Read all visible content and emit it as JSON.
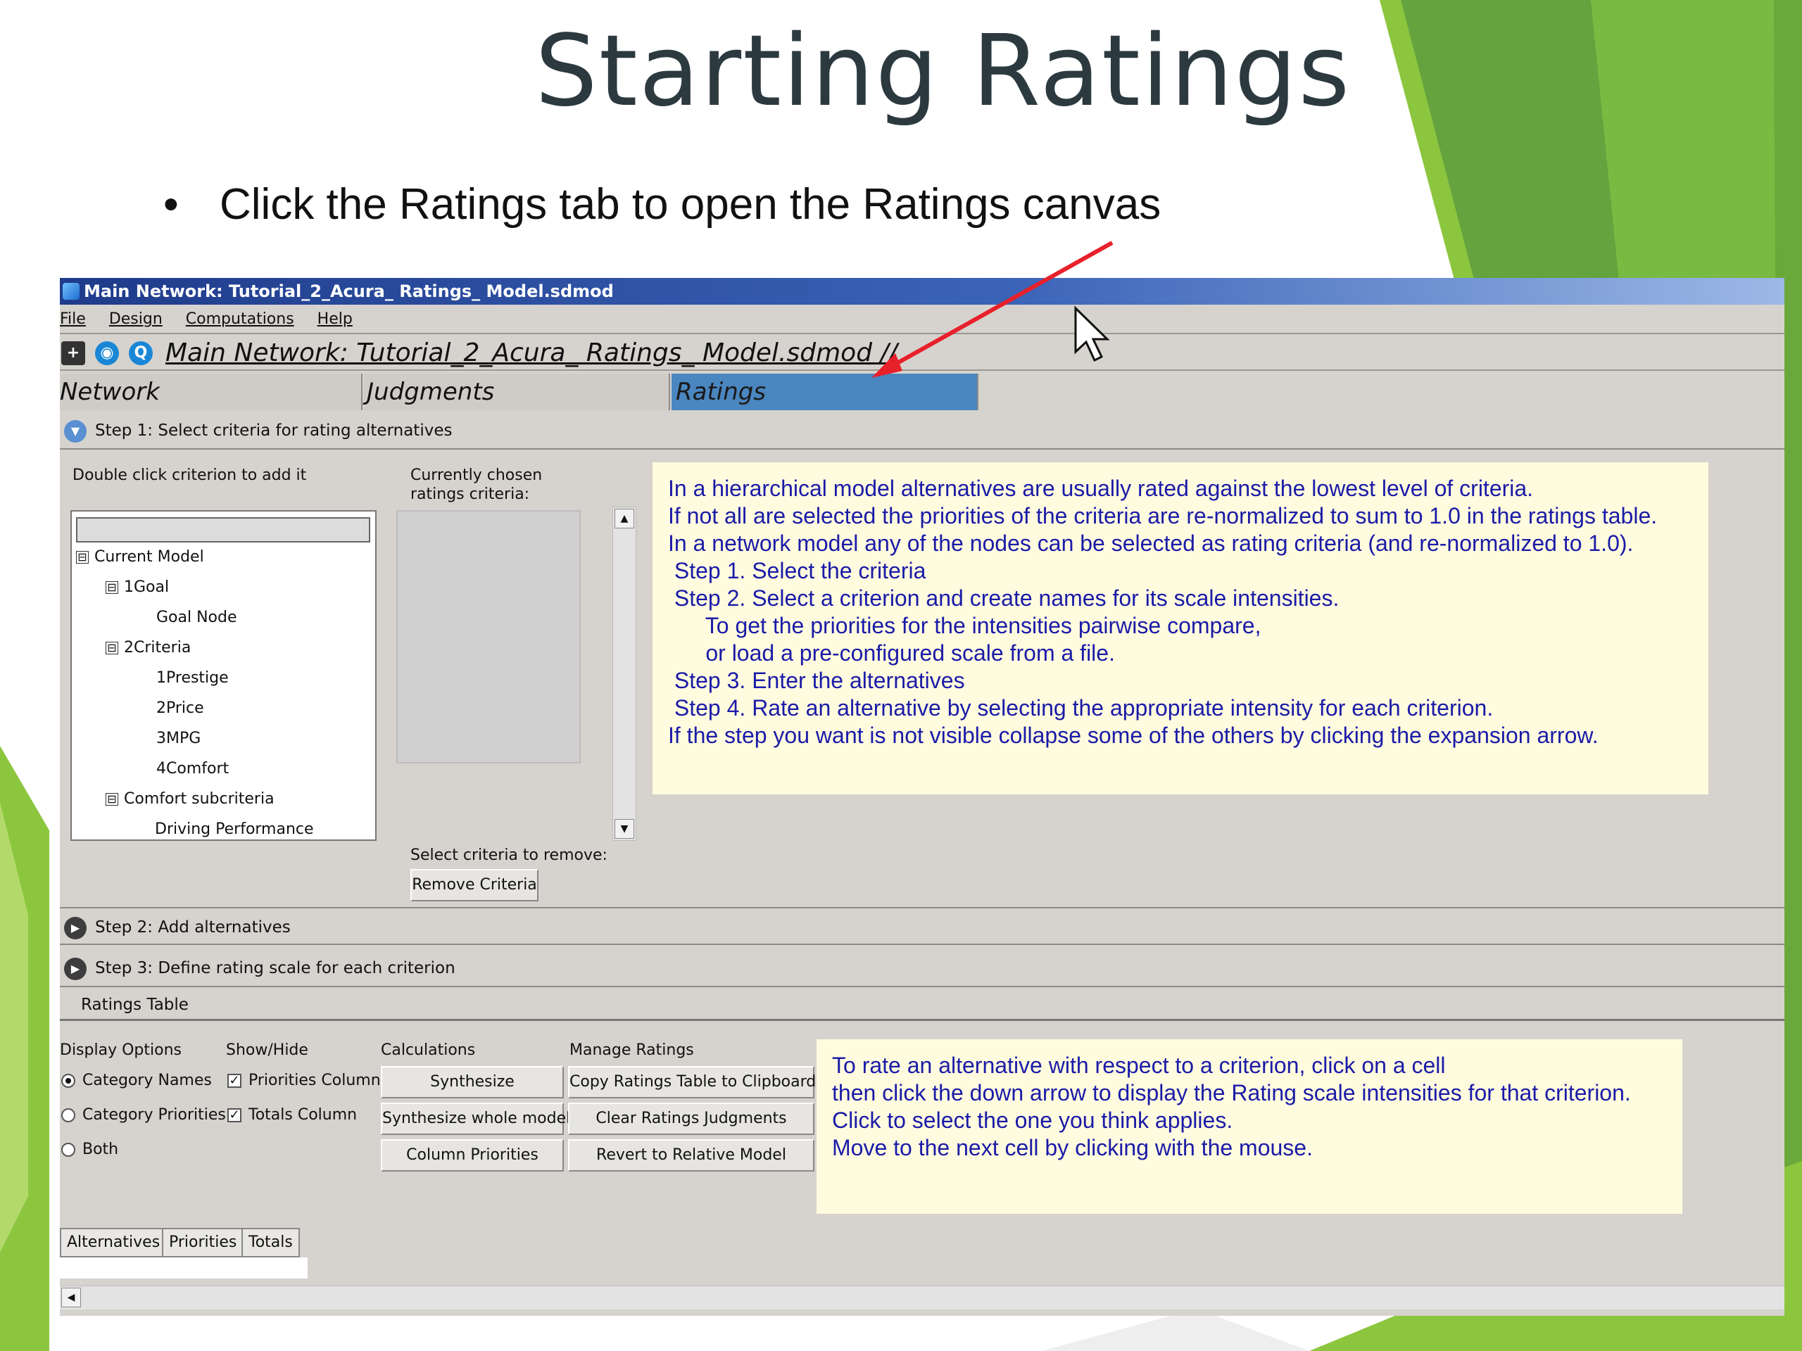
{
  "slide": {
    "title": "Starting Ratings",
    "bullet": "Click the Ratings tab to open the Ratings canvas",
    "bullet_marker": "•"
  },
  "colors": {
    "green_light": "#8cc63f",
    "green_dark": "#5a9a3c",
    "arrow_red": "#e8202a",
    "note_bg": "#fffbdf",
    "note_text": "#1b1ba7",
    "tab_active": "#4a86c0"
  },
  "window": {
    "title": "Main Network: Tutorial_2_Acura_ Ratings_ Model.sdmod",
    "menu": [
      "File",
      "Design",
      "Computations",
      "Help"
    ],
    "path": "Main Network: Tutorial_2_Acura_ Ratings_ Model.sdmod //",
    "tabs": [
      "Network",
      "Judgments",
      "Ratings"
    ],
    "active_tab": "Ratings"
  },
  "step1": {
    "label": "Step 1: Select criteria for rating alternatives",
    "tree_label": "Double click criterion to add it",
    "chosen_label_1": "Currently chosen",
    "chosen_label_2": "ratings criteria:",
    "tree": [
      {
        "label": "Current Model",
        "expander": "⊟"
      },
      {
        "label": "1Goal",
        "expander": "⊟"
      },
      {
        "label": "Goal Node",
        "expander": ""
      },
      {
        "label": "2Criteria",
        "expander": "⊟"
      },
      {
        "label": "1Prestige",
        "expander": ""
      },
      {
        "label": "2Price",
        "expander": ""
      },
      {
        "label": "3MPG",
        "expander": ""
      },
      {
        "label": "4Comfort",
        "expander": ""
      },
      {
        "label": "Comfort subcriteria",
        "expander": "⊟"
      },
      {
        "label": "Driving Performance",
        "expander": ""
      }
    ],
    "remove_label": "Select criteria to remove:",
    "remove_button": "Remove Criteria",
    "info_text": "In a hierarchical model alternatives are usually rated against the lowest level of criteria.\nIf not all are selected the priorities of the criteria are re-normalized to sum to 1.0 in the ratings table.\nIn a network model any of the nodes can be selected as rating criteria (and re-normalized to 1.0).\n Step 1. Select the criteria\n Step 2. Select a criterion and create names for its scale intensities.\n      To get the priorities for the intensities pairwise compare,\n      or load a pre-configured scale from a file.\n Step 3. Enter the alternatives\n Step 4. Rate an alternative by selecting the appropriate intensity for each criterion.\nIf the step you want is not visible collapse some of the others by clicking the expansion arrow."
  },
  "step2": {
    "label": "Step 2: Add alternatives"
  },
  "step3": {
    "label": "Step 3: Define rating scale for each criterion"
  },
  "ratings_table": {
    "label": "Ratings Table",
    "display_options": {
      "heading": "Display Options",
      "options": [
        "Category Names",
        "Category Priorities",
        "Both"
      ],
      "selected": "Category Names"
    },
    "show_hide": {
      "heading": "Show/Hide",
      "options": [
        "Priorities Column",
        "Totals Column"
      ],
      "checked": [
        true,
        true
      ]
    },
    "calculations": {
      "heading": "Calculations",
      "buttons": [
        "Synthesize",
        "Synthesize whole model",
        "Column Priorities"
      ]
    },
    "manage": {
      "heading": "Manage Ratings",
      "buttons": [
        "Copy Ratings Table to Clipboard",
        "Clear Ratings Judgments",
        "Revert to Relative Model"
      ]
    },
    "info_text": "To rate an alternative with respect to a criterion, click on a cell\nthen click the down arrow to display the Rating scale intensities for that criterion.\nClick to select the one you think applies.\nMove to the next cell by clicking with the mouse.",
    "column_tabs": [
      "Alternatives",
      "Priorities",
      "Totals"
    ]
  }
}
